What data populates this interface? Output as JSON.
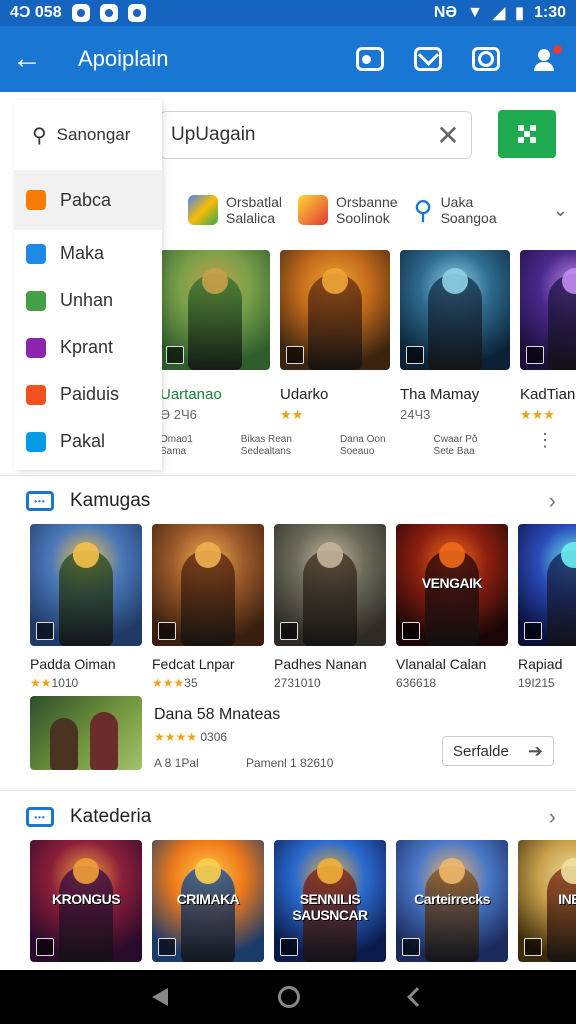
{
  "status_bar": {
    "left_text": "4Ͻ 058",
    "right_text": "NƏ",
    "time": "1:30"
  },
  "app_bar": {
    "title": "Apoiplain"
  },
  "drawer": {
    "search_label": "Sanongar",
    "items": [
      {
        "label": "Pabca",
        "color": "#f57c00"
      },
      {
        "label": "Maka",
        "color": "#1e88e5"
      },
      {
        "label": "Unhan",
        "color": "#43a047"
      },
      {
        "label": "Kprant",
        "color": "#8e24aa"
      },
      {
        "label": "Paiduis",
        "color": "#f4511e"
      },
      {
        "label": "Pakal",
        "color": "#039be5"
      }
    ]
  },
  "search": {
    "value": "UpUagain"
  },
  "categories": [
    {
      "line1": "Orsbatlal",
      "line2": "Salalica"
    },
    {
      "line1": "Orsbanne",
      "line2": "Soolinok"
    },
    {
      "line1": "Uaka",
      "line2": "Soangoa"
    }
  ],
  "featured": [
    {
      "name": "Uartanao",
      "meta": "Ө 2Ч6",
      "green": true
    },
    {
      "name": "Udarko",
      "meta": "★★",
      "green": false
    },
    {
      "name": "Tha Mamay",
      "meta": "24Ч3",
      "green": false
    },
    {
      "name": "KadTian",
      "meta": "★★★",
      "green": false
    }
  ],
  "featured_meta": [
    {
      "l1": "Omao1",
      "l2": "Sama"
    },
    {
      "l1": "Bikas Rean",
      "l2": "Sedealtans"
    },
    {
      "l1": "Dana Oon",
      "l2": "Soeauo"
    },
    {
      "l1": "Cwaar Pŏ",
      "l2": "Sete Baa"
    }
  ],
  "section1": {
    "title": "Kamugas",
    "games": [
      {
        "name": "Padda Oiman",
        "meta": "1010",
        "stars": "★★"
      },
      {
        "name": "Fedcat Lnpar",
        "meta": "35",
        "stars": "★★★"
      },
      {
        "name": "Padhes Nanan",
        "meta": "2731010",
        "stars": ""
      },
      {
        "name": "Vlanalal Calan",
        "meta": "636618",
        "stars": ""
      },
      {
        "name": "Rapiad",
        "meta": "19I215",
        "stars": ""
      }
    ],
    "art_texts": [
      "",
      "",
      "",
      "VENGAIK",
      ""
    ]
  },
  "promo": {
    "title": "Dana 58 Mnateas",
    "rating": "0306",
    "stars": "★★★★",
    "left_meta": "A 8 1Pal",
    "right_meta": "Pamenl 1 82610",
    "button_label": "Serfalde"
  },
  "section2": {
    "title": "Katederia",
    "art_texts": [
      "KRONGUS",
      "CRIMAKA",
      "SENNILIS SAUSNCAR",
      "Carteirrecks",
      "INER"
    ]
  },
  "colors": {
    "primary": "#1976d2",
    "accent_green": "#1eab4f",
    "star": "#f4a11a"
  }
}
